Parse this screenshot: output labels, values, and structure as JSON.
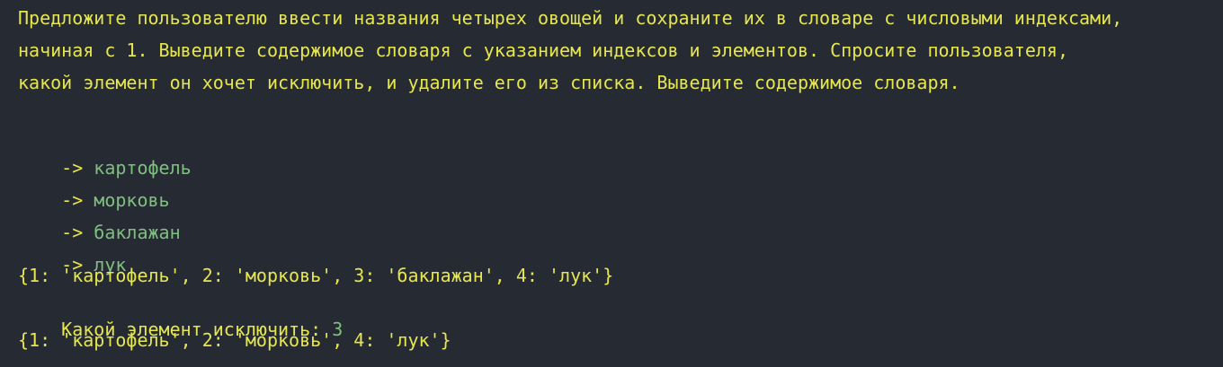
{
  "task": {
    "line1": "Предложите пользователю ввести названия четырех овощей и сохраните их в словаре с числовыми индексами,",
    "line2": "начиная с 1. Выведите содержимое словаря с указанием индексов и элементов. Спросите пользователя,",
    "line3": "какой элемент он хочет исключить, и удалите его из списка. Выведите содержимое словаря."
  },
  "output": {
    "prompt_arrow": "-> ",
    "inputs": [
      "картофель",
      "морковь",
      "баклажан",
      "лук"
    ],
    "dict_before": "{1: 'картофель', 2: 'морковь', 3: 'баклажан', 4: 'лук'}",
    "remove_prompt": "Какой элемент исключить: ",
    "remove_input": "3",
    "dict_after": "{1: 'картофель', 2: 'морковь', 4: 'лук'}"
  },
  "colors": {
    "background": "#262a33",
    "text_yellow": "#e6e64f",
    "input_green": "#7fbf7f"
  }
}
